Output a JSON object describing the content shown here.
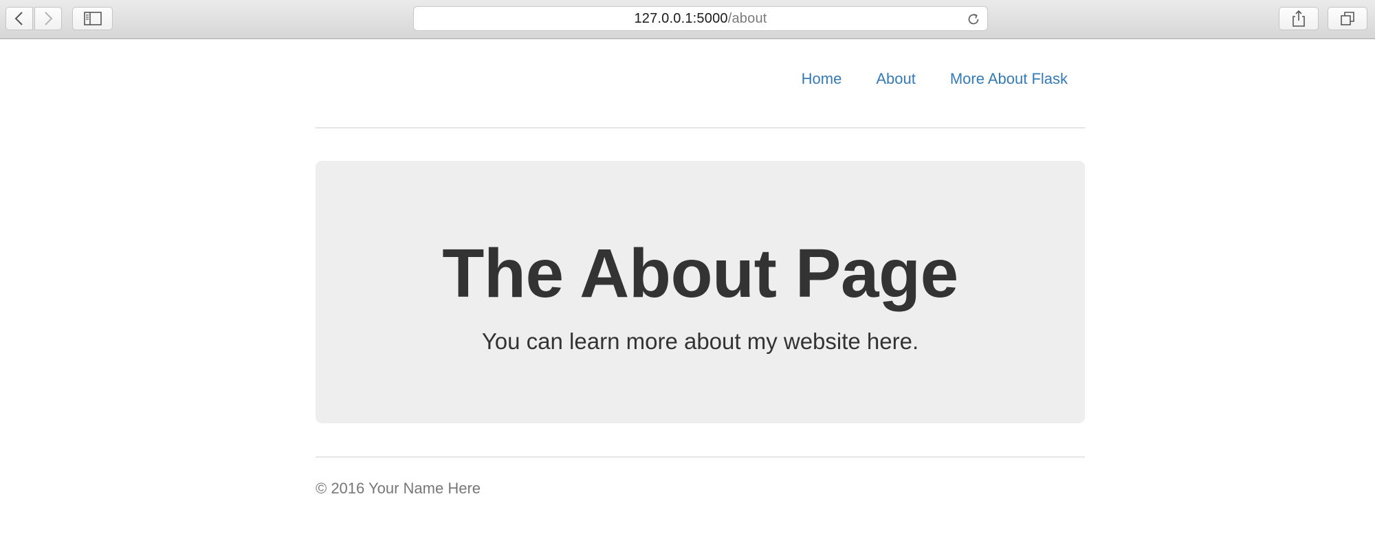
{
  "browser": {
    "url_host": "127.0.0.1:5000",
    "url_path": "/about",
    "icons": {
      "back": "chevron-left-icon",
      "forward": "chevron-right-icon",
      "sidebar": "sidebar-icon",
      "reload": "reload-icon",
      "share": "share-icon",
      "tabs": "tabs-icon"
    }
  },
  "nav": {
    "items": [
      {
        "label": "Home"
      },
      {
        "label": "About"
      },
      {
        "label": "More About Flask"
      }
    ]
  },
  "jumbotron": {
    "title": "The About Page",
    "lead": "You can learn more about my website here."
  },
  "footer": {
    "text": "© 2016 Your Name Here"
  },
  "colors": {
    "link": "#337ab7",
    "heading": "#333333",
    "jumbotron_bg": "#eeeeee",
    "footer_text": "#777777"
  }
}
